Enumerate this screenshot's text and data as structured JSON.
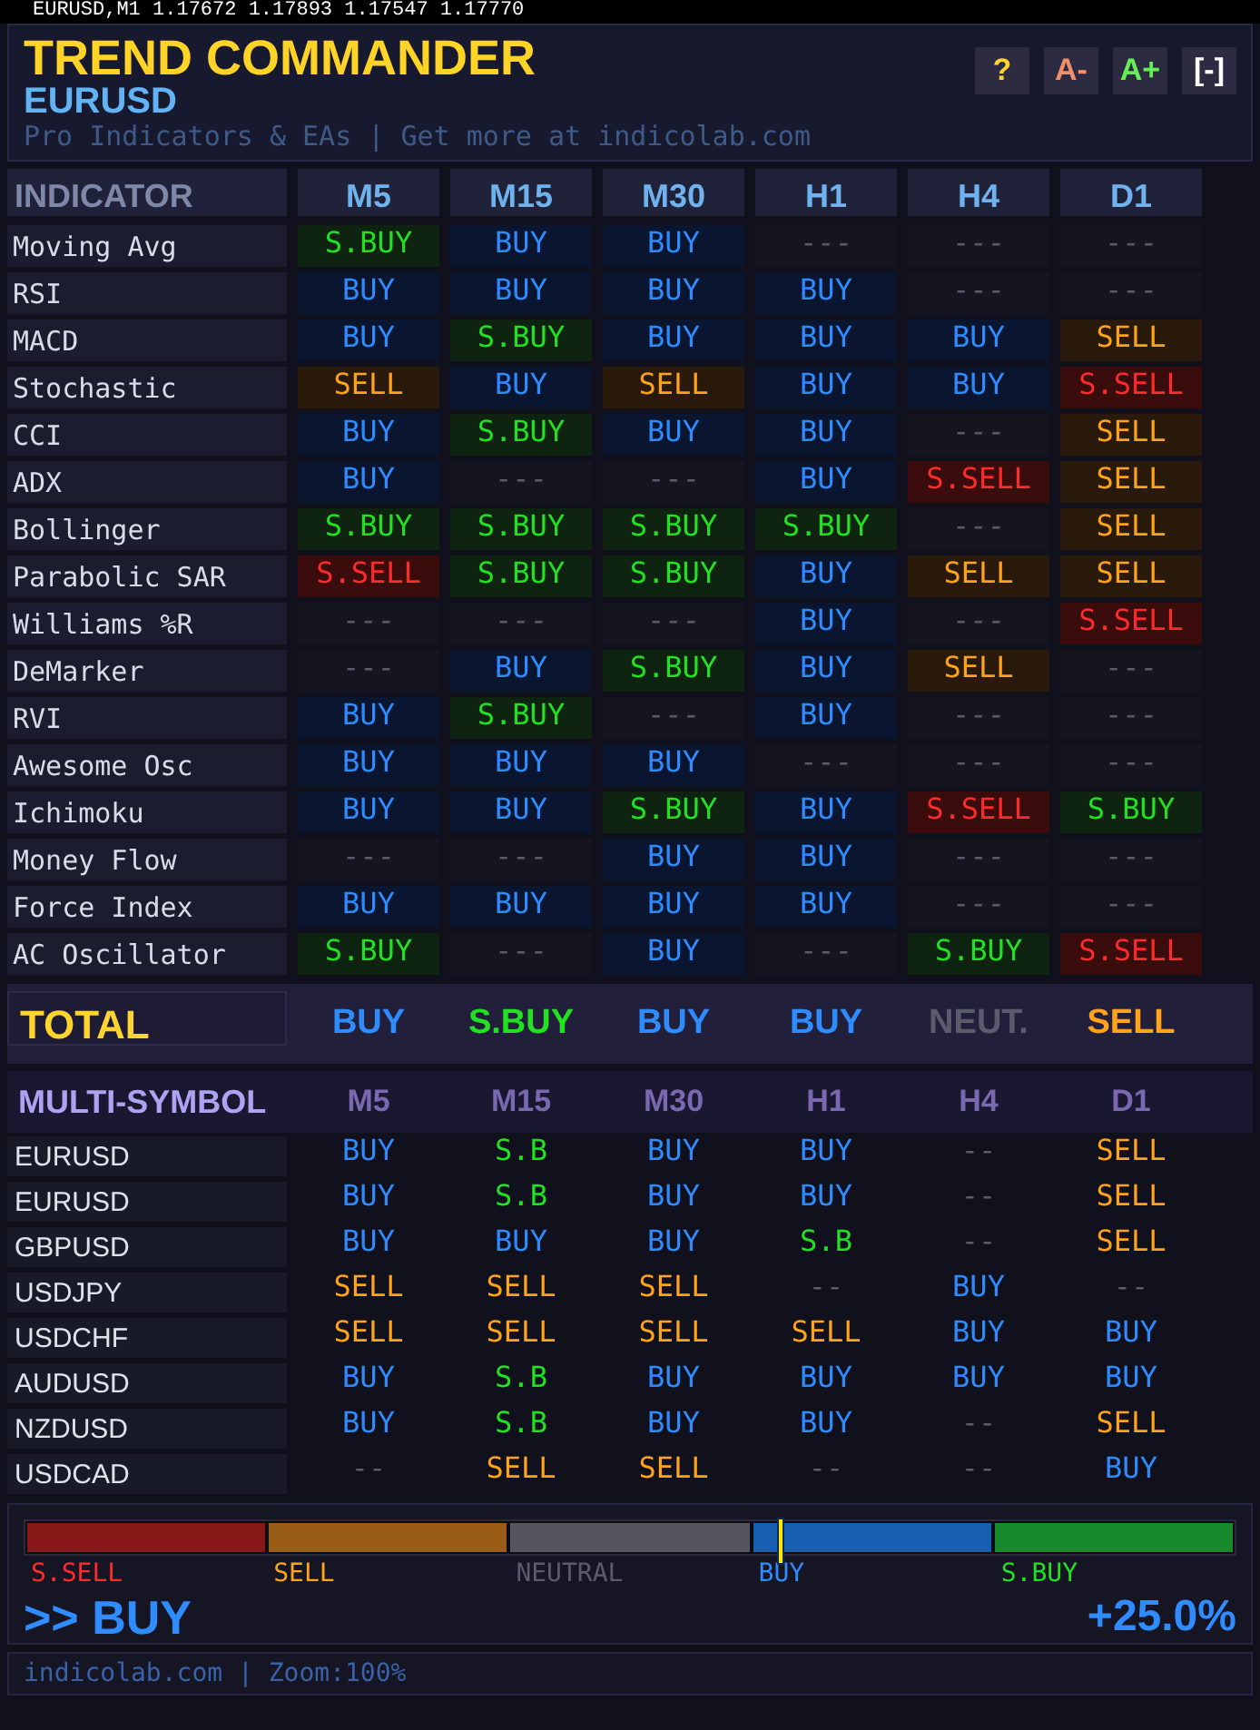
{
  "chart_header": "EURUSD,M1  1.17672 1.17893 1.17547 1.17770",
  "panel": {
    "title": "TREND COMMANDER",
    "symbol": "EURUSD",
    "subtitle": "Pro Indicators & EAs | Get more at indicolab.com",
    "buttons": [
      {
        "label": "?",
        "kind": "help"
      },
      {
        "label": "A-",
        "kind": "smaller"
      },
      {
        "label": "A+",
        "kind": "larger"
      },
      {
        "label": "[-]",
        "kind": "collapse"
      }
    ]
  },
  "indicators": {
    "heading": "INDICATOR",
    "columns": [
      "M5",
      "M15",
      "M30",
      "H1",
      "H4",
      "D1"
    ],
    "rows": [
      {
        "name": "Moving Avg",
        "cells": [
          {
            "text": "S.BUY",
            "kind": "strong_buy"
          },
          {
            "text": "BUY",
            "kind": "buy"
          },
          {
            "text": "BUY",
            "kind": "buy"
          },
          {
            "text": "---",
            "kind": "neutral"
          },
          {
            "text": "---",
            "kind": "neutral"
          },
          {
            "text": "---",
            "kind": "neutral"
          }
        ]
      },
      {
        "name": "RSI",
        "cells": [
          {
            "text": "BUY",
            "kind": "buy"
          },
          {
            "text": "BUY",
            "kind": "buy"
          },
          {
            "text": "BUY",
            "kind": "buy"
          },
          {
            "text": "BUY",
            "kind": "buy"
          },
          {
            "text": "---",
            "kind": "neutral"
          },
          {
            "text": "---",
            "kind": "neutral"
          }
        ]
      },
      {
        "name": "MACD",
        "cells": [
          {
            "text": "BUY",
            "kind": "buy"
          },
          {
            "text": "S.BUY",
            "kind": "strong_buy"
          },
          {
            "text": "BUY",
            "kind": "buy"
          },
          {
            "text": "BUY",
            "kind": "buy"
          },
          {
            "text": "BUY",
            "kind": "buy"
          },
          {
            "text": "SELL",
            "kind": "sell"
          }
        ]
      },
      {
        "name": "Stochastic",
        "cells": [
          {
            "text": "SELL",
            "kind": "sell"
          },
          {
            "text": "BUY",
            "kind": "buy"
          },
          {
            "text": "SELL",
            "kind": "sell"
          },
          {
            "text": "BUY",
            "kind": "buy"
          },
          {
            "text": "BUY",
            "kind": "buy"
          },
          {
            "text": "S.SELL",
            "kind": "strong_sell"
          }
        ]
      },
      {
        "name": "CCI",
        "cells": [
          {
            "text": "BUY",
            "kind": "buy"
          },
          {
            "text": "S.BUY",
            "kind": "strong_buy"
          },
          {
            "text": "BUY",
            "kind": "buy"
          },
          {
            "text": "BUY",
            "kind": "buy"
          },
          {
            "text": "---",
            "kind": "neutral"
          },
          {
            "text": "SELL",
            "kind": "sell"
          }
        ]
      },
      {
        "name": "ADX",
        "cells": [
          {
            "text": "BUY",
            "kind": "buy"
          },
          {
            "text": "---",
            "kind": "neutral"
          },
          {
            "text": "---",
            "kind": "neutral"
          },
          {
            "text": "BUY",
            "kind": "buy"
          },
          {
            "text": "S.SELL",
            "kind": "strong_sell"
          },
          {
            "text": "SELL",
            "kind": "sell"
          }
        ]
      },
      {
        "name": "Bollinger",
        "cells": [
          {
            "text": "S.BUY",
            "kind": "strong_buy"
          },
          {
            "text": "S.BUY",
            "kind": "strong_buy"
          },
          {
            "text": "S.BUY",
            "kind": "strong_buy"
          },
          {
            "text": "S.BUY",
            "kind": "strong_buy"
          },
          {
            "text": "---",
            "kind": "neutral"
          },
          {
            "text": "SELL",
            "kind": "sell"
          }
        ]
      },
      {
        "name": "Parabolic SAR",
        "cells": [
          {
            "text": "S.SELL",
            "kind": "strong_sell"
          },
          {
            "text": "S.BUY",
            "kind": "strong_buy"
          },
          {
            "text": "S.BUY",
            "kind": "strong_buy"
          },
          {
            "text": "BUY",
            "kind": "buy"
          },
          {
            "text": "SELL",
            "kind": "sell"
          },
          {
            "text": "SELL",
            "kind": "sell"
          }
        ]
      },
      {
        "name": "Williams %R",
        "cells": [
          {
            "text": "---",
            "kind": "neutral"
          },
          {
            "text": "---",
            "kind": "neutral"
          },
          {
            "text": "---",
            "kind": "neutral"
          },
          {
            "text": "BUY",
            "kind": "buy"
          },
          {
            "text": "---",
            "kind": "neutral"
          },
          {
            "text": "S.SELL",
            "kind": "strong_sell"
          }
        ]
      },
      {
        "name": "DeMarker",
        "cells": [
          {
            "text": "---",
            "kind": "neutral"
          },
          {
            "text": "BUY",
            "kind": "buy"
          },
          {
            "text": "S.BUY",
            "kind": "strong_buy"
          },
          {
            "text": "BUY",
            "kind": "buy"
          },
          {
            "text": "SELL",
            "kind": "sell"
          },
          {
            "text": "---",
            "kind": "neutral"
          }
        ]
      },
      {
        "name": "RVI",
        "cells": [
          {
            "text": "BUY",
            "kind": "buy"
          },
          {
            "text": "S.BUY",
            "kind": "strong_buy"
          },
          {
            "text": "---",
            "kind": "neutral"
          },
          {
            "text": "BUY",
            "kind": "buy"
          },
          {
            "text": "---",
            "kind": "neutral"
          },
          {
            "text": "---",
            "kind": "neutral"
          }
        ]
      },
      {
        "name": "Awesome Osc",
        "cells": [
          {
            "text": "BUY",
            "kind": "buy"
          },
          {
            "text": "BUY",
            "kind": "buy"
          },
          {
            "text": "BUY",
            "kind": "buy"
          },
          {
            "text": "---",
            "kind": "neutral"
          },
          {
            "text": "---",
            "kind": "neutral"
          },
          {
            "text": "---",
            "kind": "neutral"
          }
        ]
      },
      {
        "name": "Ichimoku",
        "cells": [
          {
            "text": "BUY",
            "kind": "buy"
          },
          {
            "text": "BUY",
            "kind": "buy"
          },
          {
            "text": "S.BUY",
            "kind": "strong_buy"
          },
          {
            "text": "BUY",
            "kind": "buy"
          },
          {
            "text": "S.SELL",
            "kind": "strong_sell"
          },
          {
            "text": "S.BUY",
            "kind": "strong_buy"
          }
        ]
      },
      {
        "name": "Money Flow",
        "cells": [
          {
            "text": "---",
            "kind": "neutral"
          },
          {
            "text": "---",
            "kind": "neutral"
          },
          {
            "text": "BUY",
            "kind": "buy"
          },
          {
            "text": "BUY",
            "kind": "buy"
          },
          {
            "text": "---",
            "kind": "neutral"
          },
          {
            "text": "---",
            "kind": "neutral"
          }
        ]
      },
      {
        "name": "Force Index",
        "cells": [
          {
            "text": "BUY",
            "kind": "buy"
          },
          {
            "text": "BUY",
            "kind": "buy"
          },
          {
            "text": "BUY",
            "kind": "buy"
          },
          {
            "text": "BUY",
            "kind": "buy"
          },
          {
            "text": "---",
            "kind": "neutral"
          },
          {
            "text": "---",
            "kind": "neutral"
          }
        ]
      },
      {
        "name": "AC Oscillator",
        "cells": [
          {
            "text": "S.BUY",
            "kind": "strong_buy"
          },
          {
            "text": "---",
            "kind": "neutral"
          },
          {
            "text": "BUY",
            "kind": "buy"
          },
          {
            "text": "---",
            "kind": "neutral"
          },
          {
            "text": "S.BUY",
            "kind": "strong_buy"
          },
          {
            "text": "S.SELL",
            "kind": "strong_sell"
          }
        ]
      }
    ]
  },
  "total": {
    "label": "TOTAL",
    "cells": [
      {
        "text": "BUY",
        "kind": "buy"
      },
      {
        "text": "S.BUY",
        "kind": "strong_buy"
      },
      {
        "text": "BUY",
        "kind": "buy"
      },
      {
        "text": "BUY",
        "kind": "buy"
      },
      {
        "text": "NEUT.",
        "kind": "neutral"
      },
      {
        "text": "SELL",
        "kind": "sell"
      }
    ]
  },
  "multi_symbol": {
    "heading": "MULTI-SYMBOL",
    "columns": [
      "M5",
      "M15",
      "M30",
      "H1",
      "H4",
      "D1"
    ],
    "rows": [
      {
        "symbol": "EURUSD",
        "cells": [
          {
            "text": "BUY",
            "kind": "buy"
          },
          {
            "text": "S.B",
            "kind": "strong_buy"
          },
          {
            "text": "BUY",
            "kind": "buy"
          },
          {
            "text": "BUY",
            "kind": "buy"
          },
          {
            "text": "--",
            "kind": "neutral"
          },
          {
            "text": "SELL",
            "kind": "sell"
          }
        ]
      },
      {
        "symbol": "EURUSD",
        "cells": [
          {
            "text": "BUY",
            "kind": "buy"
          },
          {
            "text": "S.B",
            "kind": "strong_buy"
          },
          {
            "text": "BUY",
            "kind": "buy"
          },
          {
            "text": "BUY",
            "kind": "buy"
          },
          {
            "text": "--",
            "kind": "neutral"
          },
          {
            "text": "SELL",
            "kind": "sell"
          }
        ]
      },
      {
        "symbol": "GBPUSD",
        "cells": [
          {
            "text": "BUY",
            "kind": "buy"
          },
          {
            "text": "BUY",
            "kind": "buy"
          },
          {
            "text": "BUY",
            "kind": "buy"
          },
          {
            "text": "S.B",
            "kind": "strong_buy"
          },
          {
            "text": "--",
            "kind": "neutral"
          },
          {
            "text": "SELL",
            "kind": "sell"
          }
        ]
      },
      {
        "symbol": "USDJPY",
        "cells": [
          {
            "text": "SELL",
            "kind": "sell"
          },
          {
            "text": "SELL",
            "kind": "sell"
          },
          {
            "text": "SELL",
            "kind": "sell"
          },
          {
            "text": "--",
            "kind": "neutral"
          },
          {
            "text": "BUY",
            "kind": "buy"
          },
          {
            "text": "--",
            "kind": "neutral"
          }
        ]
      },
      {
        "symbol": "USDCHF",
        "cells": [
          {
            "text": "SELL",
            "kind": "sell"
          },
          {
            "text": "SELL",
            "kind": "sell"
          },
          {
            "text": "SELL",
            "kind": "sell"
          },
          {
            "text": "SELL",
            "kind": "sell"
          },
          {
            "text": "BUY",
            "kind": "buy"
          },
          {
            "text": "BUY",
            "kind": "buy"
          }
        ]
      },
      {
        "symbol": "AUDUSD",
        "cells": [
          {
            "text": "BUY",
            "kind": "buy"
          },
          {
            "text": "S.B",
            "kind": "strong_buy"
          },
          {
            "text": "BUY",
            "kind": "buy"
          },
          {
            "text": "BUY",
            "kind": "buy"
          },
          {
            "text": "BUY",
            "kind": "buy"
          },
          {
            "text": "BUY",
            "kind": "buy"
          }
        ]
      },
      {
        "symbol": "NZDUSD",
        "cells": [
          {
            "text": "BUY",
            "kind": "buy"
          },
          {
            "text": "S.B",
            "kind": "strong_buy"
          },
          {
            "text": "BUY",
            "kind": "buy"
          },
          {
            "text": "BUY",
            "kind": "buy"
          },
          {
            "text": "--",
            "kind": "neutral"
          },
          {
            "text": "SELL",
            "kind": "sell"
          }
        ]
      },
      {
        "symbol": "USDCAD",
        "cells": [
          {
            "text": "--",
            "kind": "neutral"
          },
          {
            "text": "SELL",
            "kind": "sell"
          },
          {
            "text": "SELL",
            "kind": "sell"
          },
          {
            "text": "--",
            "kind": "neutral"
          },
          {
            "text": "--",
            "kind": "neutral"
          },
          {
            "text": "BUY",
            "kind": "buy"
          }
        ]
      }
    ]
  },
  "gauge": {
    "level": 0.625,
    "segments": [
      {
        "label": "S.SELL",
        "kind": "strong_sell"
      },
      {
        "label": "SELL",
        "kind": "sell"
      },
      {
        "label": "NEUTRAL",
        "kind": "neutral"
      },
      {
        "label": "BUY",
        "kind": "buy"
      },
      {
        "label": "S.BUY",
        "kind": "strong_buy"
      }
    ]
  },
  "verdict": {
    "text": ">> BUY",
    "kind": "buy"
  },
  "score": "+25.0%",
  "footer": "indicolab.com | Zoom:100%"
}
